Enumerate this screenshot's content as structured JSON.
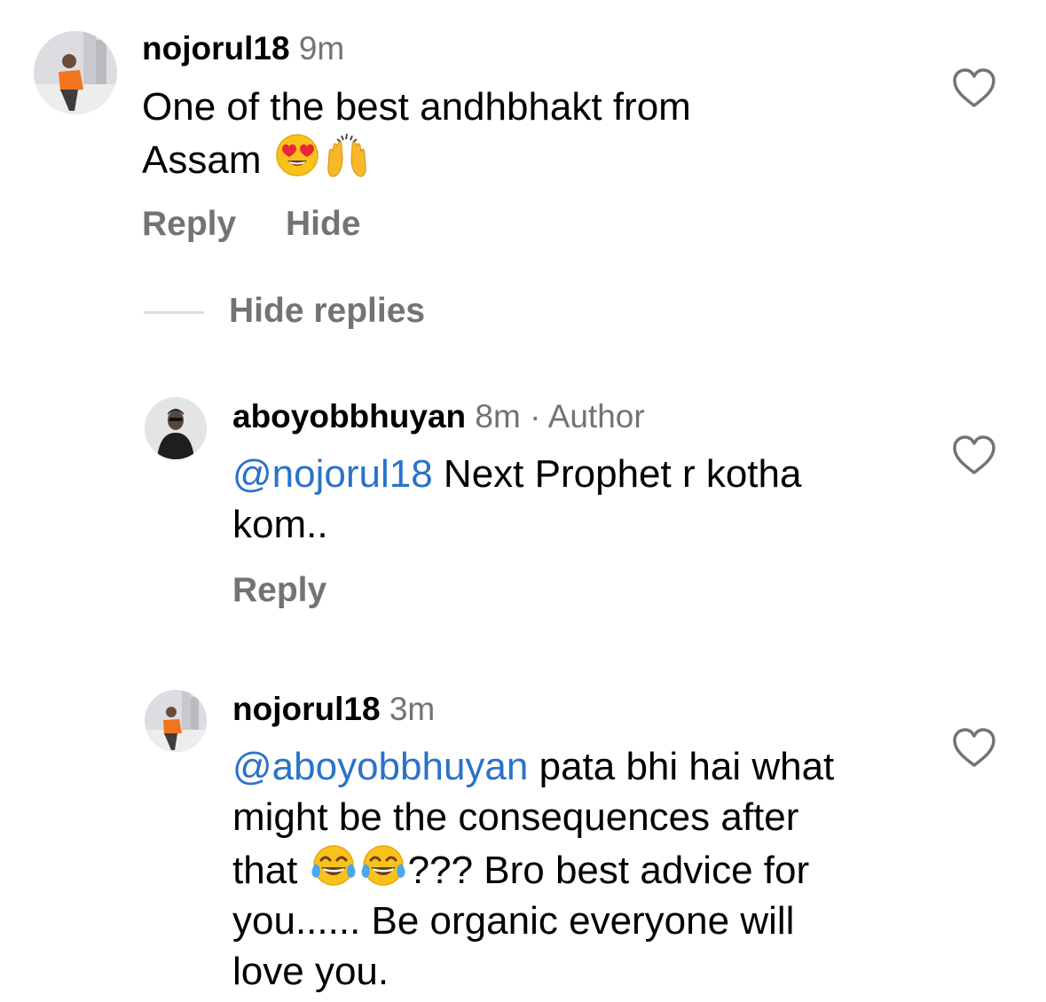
{
  "comments": [
    {
      "username": "nojorul18",
      "time": "9m",
      "text": "One of the best andhbhakt from Assam",
      "text_line1": "One of the best andhbhakt from",
      "text_line2": "Assam",
      "emojis": [
        "heart-eyes-emoji",
        "raising-hands-emoji"
      ],
      "actions": {
        "reply": "Reply",
        "hide": "Hide"
      }
    }
  ],
  "hide_replies_label": "Hide replies",
  "replies": [
    {
      "username": "aboyobbhuyan",
      "time": "8m",
      "separator": "·",
      "badge": "Author",
      "mention": "@nojorul18",
      "text_line1": " Next Prophet r kotha",
      "text_line2": "kom..",
      "actions": {
        "reply": "Reply"
      }
    },
    {
      "username": "nojorul18",
      "time": "3m",
      "mention": "@aboyobbhuyan",
      "text_line1": " pata bhi hai what",
      "text_line2": "might be the consequences after",
      "text_line3_a": "that",
      "text_line3_b": "??? Bro best advice for",
      "text_line4": "you...... Be organic everyone will",
      "text_line5": "love you.",
      "emojis": [
        "tears-of-joy-emoji",
        "tears-of-joy-emoji"
      ]
    }
  ],
  "colors": {
    "mention": "#2b72c9",
    "meta": "#737373",
    "divider": "#dbdbdb"
  }
}
